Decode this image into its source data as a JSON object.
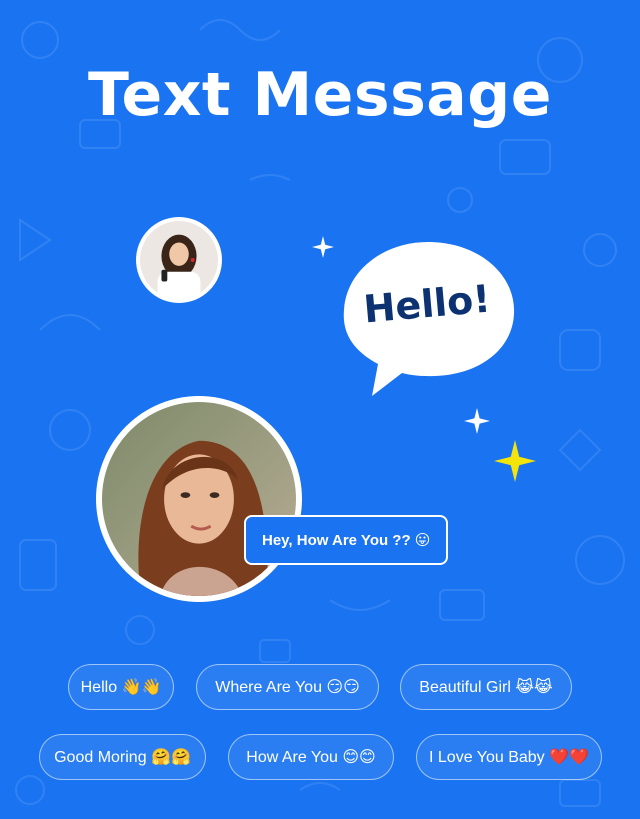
{
  "title": "Text Message",
  "speech_bubble": {
    "text": "Hello!"
  },
  "conversation": {
    "reply": "Hey, How Are You ?? 😛"
  },
  "quick_replies": [
    {
      "label": "Hello 👋👋"
    },
    {
      "label": "Where Are You 😏😏"
    },
    {
      "label": "Beautiful Girl 😹😹"
    },
    {
      "label": "Good Moring 🤗🤗"
    },
    {
      "label": "How Are You 😊😊"
    },
    {
      "label": "I Love You Baby ❤️❤️"
    }
  ],
  "colors": {
    "background": "#1a73f0",
    "bubble_text": "#0d3272",
    "sparkle_white": "#ffffff",
    "sparkle_yellow": "#f5e40a"
  }
}
